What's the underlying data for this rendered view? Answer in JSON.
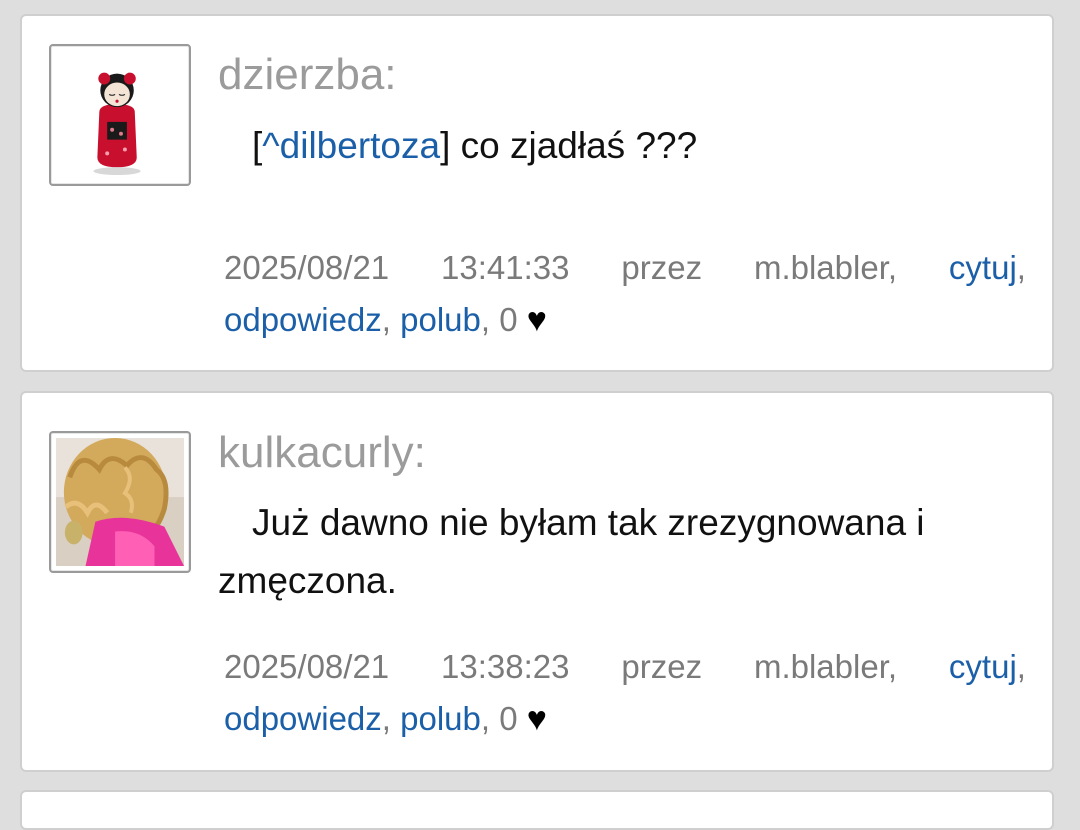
{
  "posts": [
    {
      "author": "dzierzba:",
      "mention": "^dilbertoza",
      "bracket_open": "[",
      "bracket_close": "]",
      "text": " co zjadłaś ???",
      "date": "2025/08/21",
      "time": "13:41:33",
      "by_label": "przez",
      "by_user": "m.blabler,",
      "quote_label": "cytuj",
      "reply_label": "odpowiedz",
      "like_label": "polub",
      "likes_count": "0",
      "heart": "♥",
      "avatar_icon": "kokeshi-doll-avatar-icon"
    },
    {
      "author": "kulkacurly:",
      "text": "Już dawno nie byłam tak zrezygnowana i zmęczona.",
      "date": "2025/08/21",
      "time": "13:38:23",
      "by_label": "przez",
      "by_user": "m.blabler,",
      "quote_label": "cytuj",
      "reply_label": "odpowiedz",
      "like_label": "polub",
      "likes_count": "0",
      "heart": "♥",
      "avatar_icon": "curly-hair-person-avatar-icon"
    }
  ],
  "colors": {
    "link": "#1a5fa8",
    "author": "#9b9b9b",
    "meta": "#7a7a7a",
    "background": "#dedede"
  }
}
